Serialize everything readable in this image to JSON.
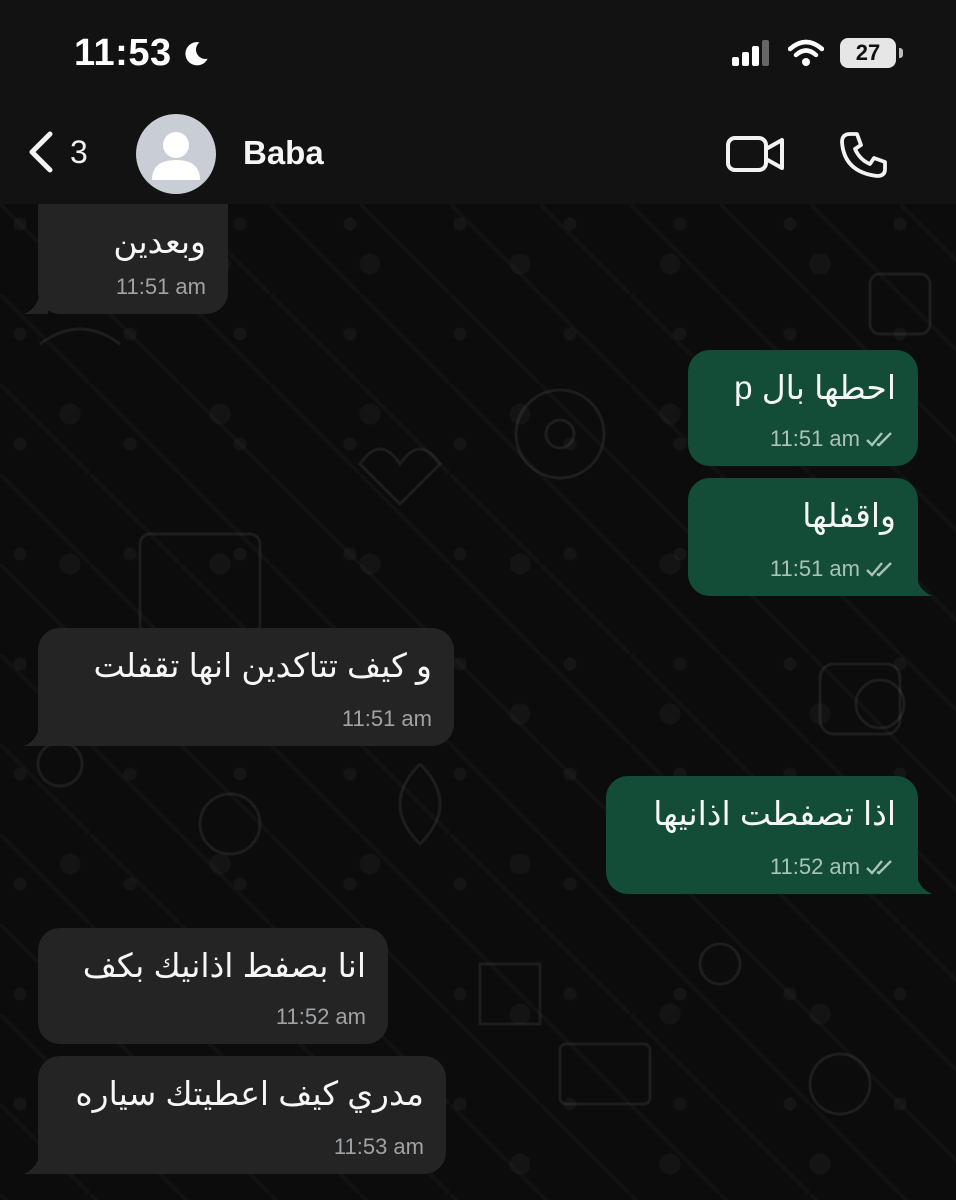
{
  "status_bar": {
    "time": "11:53",
    "battery": "27"
  },
  "header": {
    "back_count": "3",
    "contact_name": "Baba"
  },
  "messages": [
    {
      "direction": "in",
      "text": "وبعدين",
      "time": "11:51 am"
    },
    {
      "direction": "out",
      "text": "احطها بال p",
      "time": "11:51 am"
    },
    {
      "direction": "out",
      "text": "واقفلها",
      "time": "11:51 am"
    },
    {
      "direction": "in",
      "text": "و كيف تتاكدين انها تقفلت",
      "time": "11:51 am"
    },
    {
      "direction": "out",
      "text": "اذا تصفطت اذانيها",
      "time": "11:52 am"
    },
    {
      "direction": "in",
      "text": "انا بصفط اذانيك بكف",
      "time": "11:52 am"
    },
    {
      "direction": "in",
      "text": "مدري كيف اعطيتك سياره",
      "time": "11:53 am"
    }
  ],
  "colors": {
    "incoming_bubble": "#242424",
    "outgoing_bubble": "#134d37",
    "background": "#0c0c0c"
  },
  "icons": {
    "back": "chevron-left-icon",
    "video": "video-camera-icon",
    "call": "phone-icon",
    "read_receipt": "double-check-icon"
  }
}
